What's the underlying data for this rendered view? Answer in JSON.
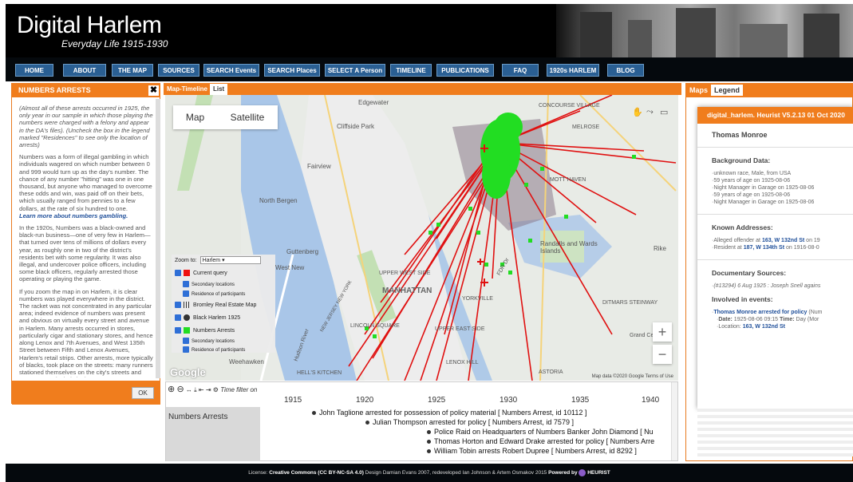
{
  "header": {
    "title": "Digital Harlem",
    "subtitle": "Everyday Life 1915-1930"
  },
  "nav": [
    "HOME",
    "ABOUT",
    "THE MAP",
    "SOURCES",
    "SEARCH Events",
    "SEARCH Places",
    "SELECT A Person",
    "TIMELINE",
    "PUBLICATIONS",
    "FAQ",
    "1920s HARLEM",
    "BLOG"
  ],
  "left_panel": {
    "title": "NUMBERS ARRESTS",
    "close": "✖",
    "intro": "(Almost all of these arrests occurred in 1925, the only year in our sample in which those playing the numbers were charged with a felony and appear in the DA's files). (Uncheck the box in the legend marked \"Residences\" to see only the location of arrests)",
    "para1": "Numbers was a form of illegal gambling in which individuals wagered on which number between 0 and 999 would turn up as the day's number. The chance of any number \"hitting\" was one in one thousand, but anyone who managed to overcome these odds and win, was paid off on their bets, which usually ranged from pennies to a few dollars, at the rate of six hundred to one.",
    "link": "Learn more about numbers gambling.",
    "para2": "In the 1920s, Numbers was a black-owned and black-run business—one of very few in Harlem—that turned over tens of millions of dollars every year, as roughly one in two of the district's residents bet with some regularity. It was also illegal, and undercover police officers, including some black officers, regularly arrested those operating or playing the game.",
    "para3": "If you zoom the map in on Harlem, it is clear numbers was played everywhere in the district. The racket was not concentrated in any particular area; indeed evidence of numbers was present and obvious on virtually every street and avenue in Harlem. Many arrests occurred in stores, particularly cigar and stationary stores, and hence along Lenox and 7th Avenues, and West 135th Street between Fifth and Lenox Avenues, Harlem's retail strips. Other arrests, more typically of blacks, took place on the streets: many runners stationed themselves on the city's streets and avenues, particularly in the",
    "ok": "OK"
  },
  "map_panel": {
    "tabs": [
      "Map-Timeline",
      "List"
    ],
    "map_type": [
      "Map",
      "Satellite"
    ],
    "labels": [
      "Edgewater",
      "CONCOURSE VILLAGE",
      "MELROSE",
      "Cliffside Park",
      "Fairview",
      "North Bergen",
      "Guttenberg",
      "West New",
      "MOTT HAVEN",
      "Randalls and Wards Islands",
      "Rike",
      "UPPER WEST SIDE",
      "MANHATTAN",
      "NEW JERSEY NEW YORK",
      "LINCOLN SQUARE",
      "UPPER EAST SIDE",
      "YORKVILLE",
      "DITMARS STEINWAY",
      "Weehawken",
      "HELL'S KITCHEN",
      "LENOX HILL",
      "ASTORIA",
      "Hudson River",
      "FDR Dr",
      "Grand Ce"
    ],
    "zoom_label": "Zoom to:",
    "zoom_value": "Harlem",
    "legend": [
      {
        "label": "Current query",
        "color": "#ee1111"
      },
      {
        "label": "Secondary locations"
      },
      {
        "label": "Residence of participants"
      },
      {
        "label": "Bromley Real Estate Map"
      },
      {
        "label": "Black Harlem 1925"
      },
      {
        "label": "Numbers Arrests",
        "color": "#22dd22"
      },
      {
        "label": "Secondary locations"
      },
      {
        "label": "Residence of participants"
      }
    ],
    "google": "Google",
    "map_data": "Map data ©2020 Google",
    "terms": "Terms of Use",
    "zoom_in": "+",
    "zoom_out": "−"
  },
  "timeline": {
    "filter": "Time filter on",
    "years": [
      "1915",
      "1920",
      "1925",
      "1930",
      "1935",
      "1940"
    ],
    "row_label": "Numbers Arrests",
    "events": [
      "John Taglione arrested for possession of policy material [ Numbers Arrest, id 10112 ]",
      "Julian Thompson arrested for policy [ Numbers Arrest, id 7579 ]",
      "Police Raid on Headquarters of Numbers Banker John Diamond [ Nu",
      "Thomas Horton and Edward Drake arrested for policy [ Numbers Arre",
      "William Tobin arrests Robert Dupree [ Numbers Arrest, id 8292 ]"
    ]
  },
  "right_panel": {
    "tabs": [
      "Maps",
      "Legend"
    ],
    "record_title": "digital_harlem. Heurist V5.2.13 01 Oct 2020",
    "person": "Thomas Monroe",
    "background_hdr": "Background Data:",
    "background": [
      "unknown race, Male, from USA",
      "59 years of age on 1925-08-06",
      "Night Manager in Garage on 1925-08-06",
      "59 years of age on 1925-08-06",
      "Night Manager in Garage on 1925-08-06"
    ],
    "addresses_hdr": "Known Addresses:",
    "addresses": [
      {
        "pre": "Alleged offender at ",
        "addr": "163, W 132nd St",
        "post": " on 19"
      },
      {
        "pre": "Resident at ",
        "addr": "187, W 134th St",
        "post": " on 1916-08-0"
      }
    ],
    "doc_hdr": "Documentary Sources:",
    "doc": "(#13294) 6 Aug 1925 : Joseph Snell agains",
    "events_hdr": "Involved in events:",
    "event_title": "Thomas Monroe arrested for policy",
    "event_title_tail": " (Num",
    "event_date_lbl": "Date:",
    "event_date": " 1925-08-06 09:15 ",
    "event_time_lbl": "Time:",
    "event_time": " Day (Mor",
    "event_loc_lbl": "Location: ",
    "event_loc": "163, W 132nd St"
  },
  "footer": {
    "license_pre": "License: ",
    "license": "Creative Commons (CC BY-NC-SA 4.0)",
    "design": "  Design Damian Evans 2007, redeveloped Ian Johnson & Artem Osmakov 2015  ",
    "powered": "Powered by",
    "heurist": "HEURIST"
  }
}
